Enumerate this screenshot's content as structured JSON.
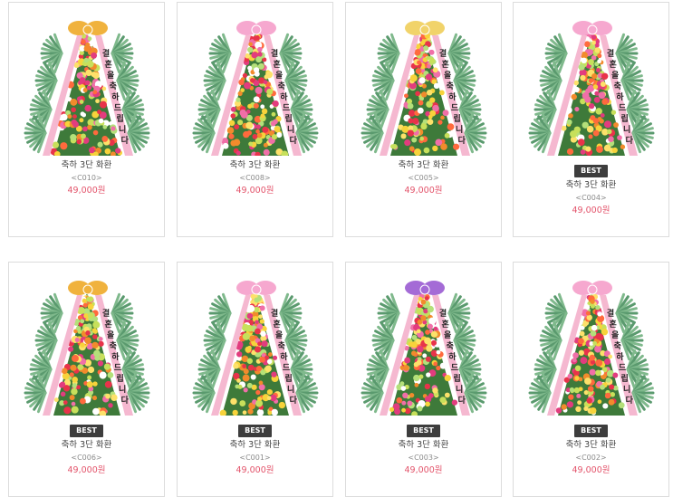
{
  "colors": {
    "price": "#e3546b",
    "badge_bg": "#3d3d3d",
    "border": "#dcdcdc"
  },
  "products": [
    {
      "name": "축하 3단 화환",
      "code": "<C010>",
      "price": "49,000원",
      "badge": "",
      "ribbon": "결혼을 축하드립니다",
      "bow": "#f0b23d"
    },
    {
      "name": "축하 3단 화환",
      "code": "<C008>",
      "price": "49,000원",
      "badge": "",
      "ribbon": "결혼을 축하드립니다",
      "bow": "#f6a8cf"
    },
    {
      "name": "축하 3단 화환",
      "code": "<C005>",
      "price": "49,000원",
      "badge": "",
      "ribbon": "결혼을 축하드립니다",
      "bow": "#f1d36a"
    },
    {
      "name": "축하 3단 화환",
      "code": "<C004>",
      "price": "49,000원",
      "badge": "BEST",
      "ribbon": "결혼을 축하드립니다",
      "bow": "#f6a8cf"
    },
    {
      "name": "축하 3단 화환",
      "code": "<C006>",
      "price": "49,000원",
      "badge": "BEST",
      "ribbon": "결혼을 축하드립니다",
      "bow": "#f0b23d"
    },
    {
      "name": "축하 3단 화환",
      "code": "<C001>",
      "price": "49,000원",
      "badge": "BEST",
      "ribbon": "결혼을 축하드립니다",
      "bow": "#f6a8cf"
    },
    {
      "name": "축하 3단 화환",
      "code": "<C003>",
      "price": "49,000원",
      "badge": "BEST",
      "ribbon": "결혼을 축하드립니다",
      "bow": "#a46bd6"
    },
    {
      "name": "축하 3단 화환",
      "code": "<C002>",
      "price": "49,000원",
      "badge": "BEST",
      "ribbon": "결혼을 축하드립니다",
      "bow": "#f6a8cf"
    }
  ]
}
